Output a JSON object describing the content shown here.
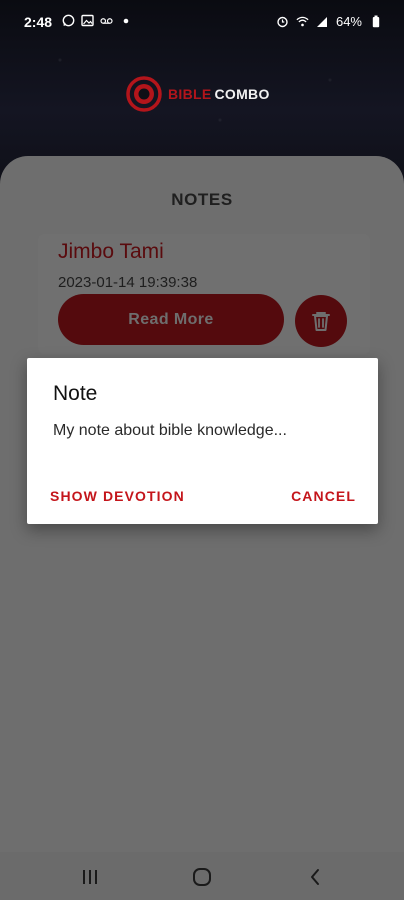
{
  "status_bar": {
    "time": "2:48",
    "battery": "64%",
    "left_icons": [
      "whatsapp-icon",
      "gallery-icon",
      "voicemail-icon",
      "dot-icon"
    ],
    "right_icons": [
      "alarm-icon",
      "wifi-icon",
      "signal-icon",
      "battery-icon"
    ]
  },
  "header": {
    "logo_word_1": "BIBLE",
    "logo_word_2": "COMBO"
  },
  "main": {
    "title": "NOTES",
    "note": {
      "name": "Jimbo Tami",
      "date": "2023-01-14 19:39:38",
      "read_more_label": "Read More",
      "delete_icon": "trash-icon"
    }
  },
  "dialog": {
    "title": "Note",
    "message": "My note about bible knowledge...",
    "show_devotion_label": "SHOW DEVOTION",
    "cancel_label": "CANCEL"
  },
  "nav": {
    "recents_icon": "recents-icon",
    "home_icon": "home-icon",
    "back_icon": "back-icon"
  },
  "colors": {
    "accent": "#c4151b",
    "dimmed_accent": "#540a0d",
    "scrim": "#6b6b6b"
  }
}
